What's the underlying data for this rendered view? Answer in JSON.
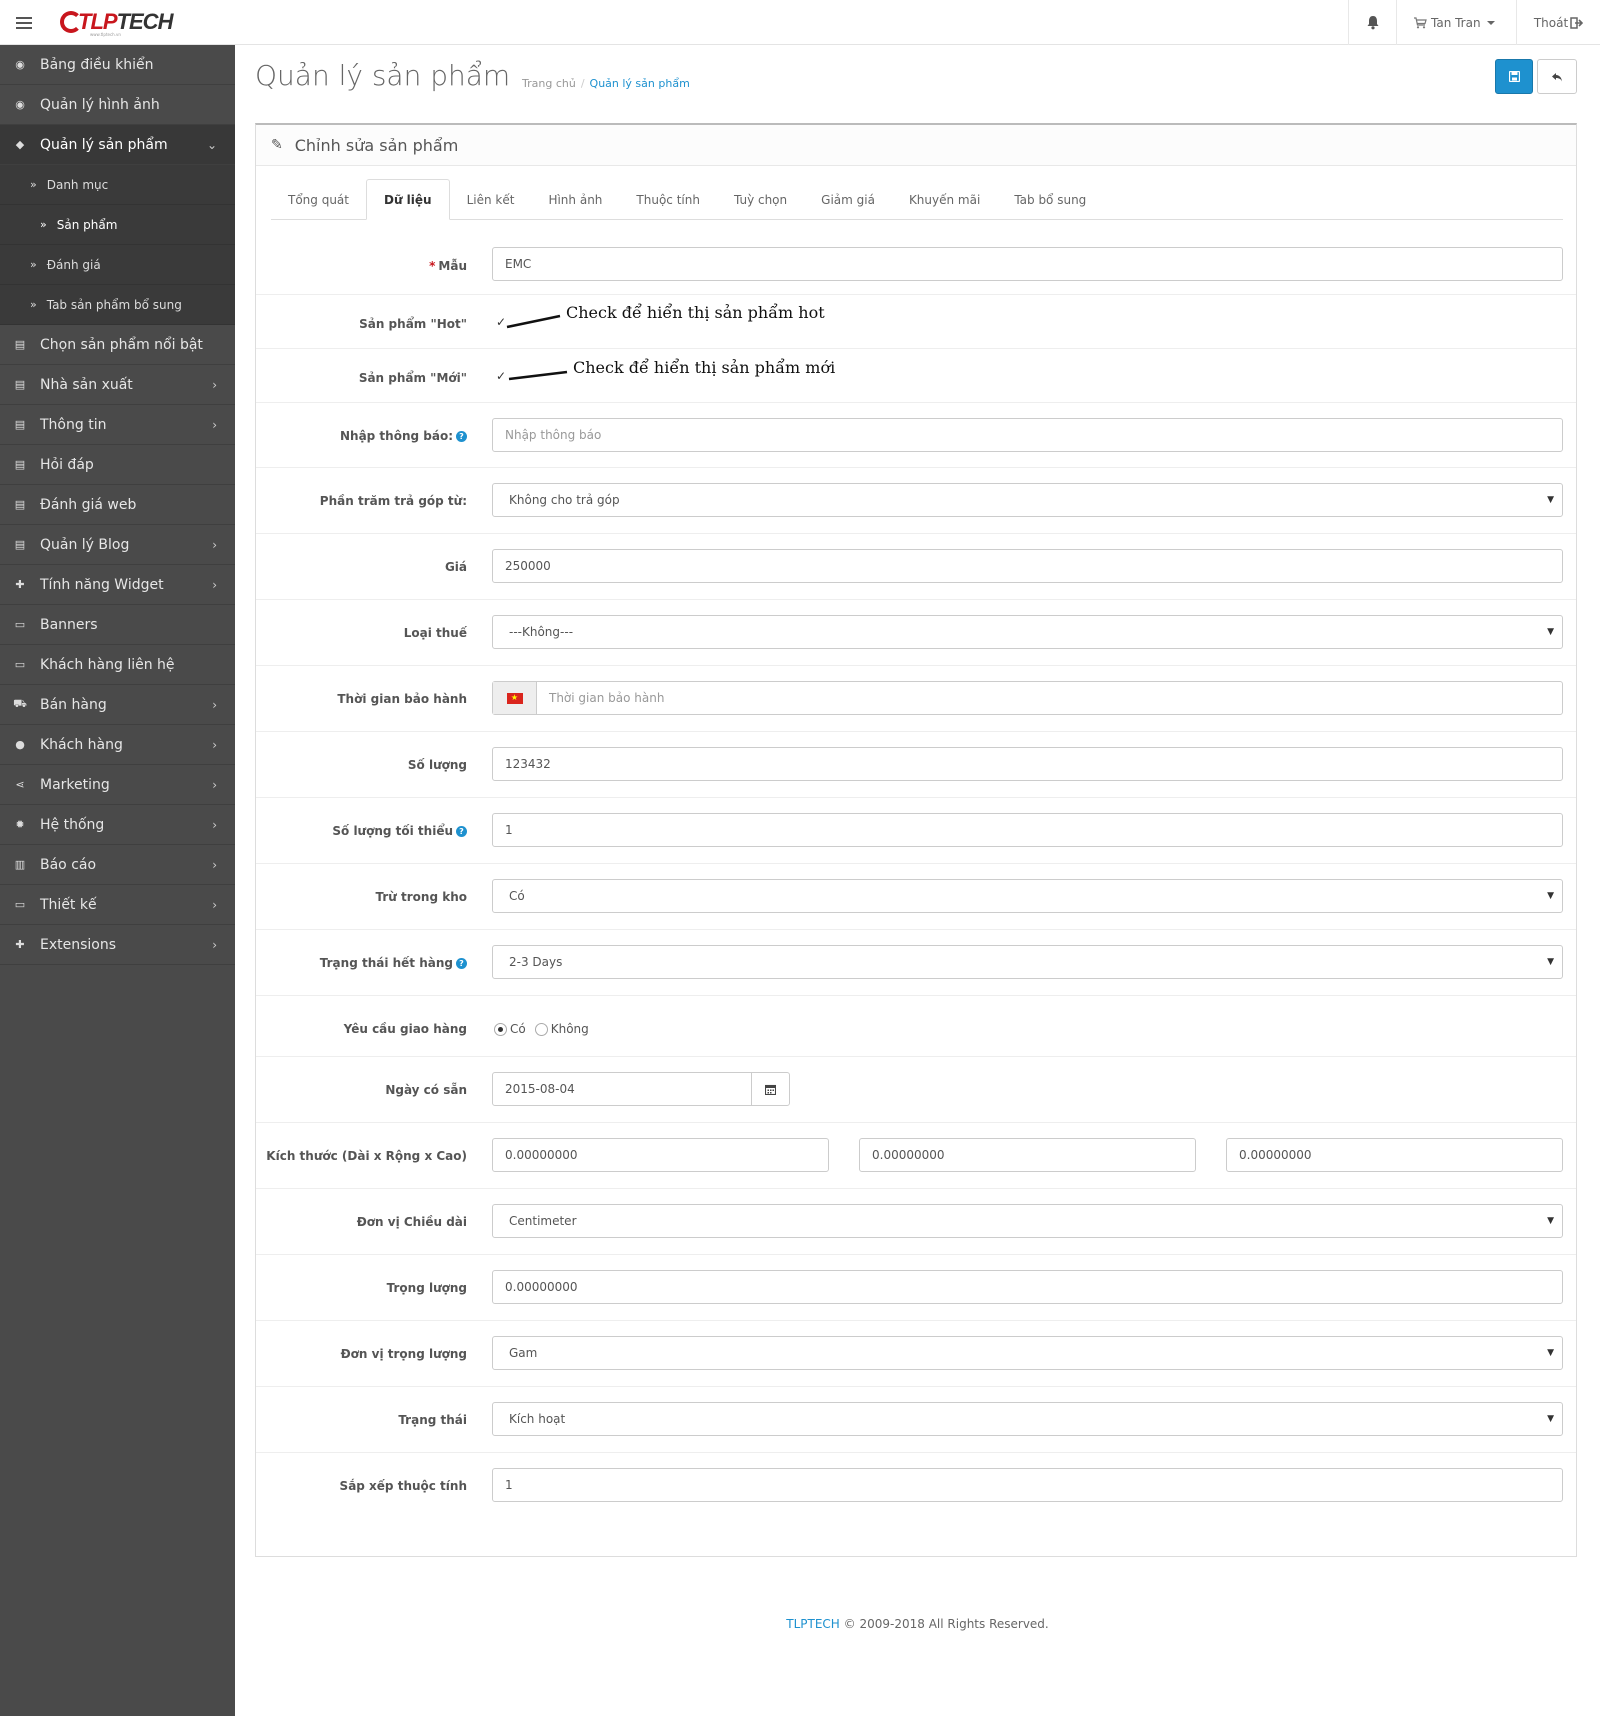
{
  "header": {
    "logo_text_red": "TLP",
    "logo_text_dark": "TECH",
    "logo_sub": "www.tlptech.vn",
    "user_name": "Tan Tran",
    "logout_label": "Thoát"
  },
  "sidebar": {
    "items": [
      {
        "label": "Bảng điều khiển",
        "icon": "dashboard-icon"
      },
      {
        "label": "Quản lý hình ảnh",
        "icon": "dashboard-icon"
      },
      {
        "label": "Quản lý sản phẩm",
        "icon": "tags-icon"
      },
      {
        "label": "Chọn sản phẩm nổi bật",
        "icon": "newspaper-icon"
      },
      {
        "label": "Nhà sản xuất",
        "icon": "newspaper-icon"
      },
      {
        "label": "Thông tin",
        "icon": "newspaper-icon"
      },
      {
        "label": "Hỏi đáp",
        "icon": "newspaper-icon"
      },
      {
        "label": "Đánh giá web",
        "icon": "newspaper-icon"
      },
      {
        "label": "Quản lý Blog",
        "icon": "newspaper-icon"
      },
      {
        "label": "Tính năng Widget",
        "icon": "puzzle-icon"
      },
      {
        "label": "Banners",
        "icon": "monitor-icon"
      },
      {
        "label": "Khách hàng liên hệ",
        "icon": "monitor-icon"
      },
      {
        "label": "Bán hàng",
        "icon": "cart-icon"
      },
      {
        "label": "Khách hàng",
        "icon": "user-icon"
      },
      {
        "label": "Marketing",
        "icon": "share-icon"
      },
      {
        "label": "Hệ thống",
        "icon": "gear-icon"
      },
      {
        "label": "Báo cáo",
        "icon": "bar-chart-icon"
      },
      {
        "label": "Thiết kế",
        "icon": "monitor-icon"
      },
      {
        "label": "Extensions",
        "icon": "puzzle-icon"
      }
    ],
    "sub_items": [
      {
        "label": "Danh mục"
      },
      {
        "label": "Sản phẩm"
      },
      {
        "label": "Đánh giá"
      },
      {
        "label": "Tab sản phẩm bổ sung"
      }
    ]
  },
  "page": {
    "title": "Quản lý sản phẩm",
    "breadcrumb_home": "Trang chủ",
    "breadcrumb_current": "Quản lý sản phẩm",
    "panel_title": "Chỉnh sửa sản phẩm"
  },
  "tabs": [
    "Tổng quát",
    "Dữ liệu",
    "Liên kết",
    "Hình ảnh",
    "Thuộc tính",
    "Tuỳ chọn",
    "Giảm giá",
    "Khuyến mãi",
    "Tab bổ sung"
  ],
  "form": {
    "model_label": "Mẫu",
    "model_value": "EMC",
    "hot_label": "Sản phẩm \"Hot\"",
    "new_label": "Sản phẩm \"Mới\"",
    "notice_label": "Nhập thông báo:",
    "notice_placeholder": "Nhập thông báo",
    "installment_label": "Phần trăm trả góp từ:",
    "installment_value": "Không cho trả góp",
    "price_label": "Giá",
    "price_value": "250000",
    "tax_label": "Loại thuế",
    "tax_value": "---Không---",
    "warranty_label": "Thời gian bảo hành",
    "warranty_placeholder": "Thời gian bảo hành",
    "quantity_label": "Số lượng",
    "quantity_value": "123432",
    "min_qty_label": "Số lượng tối thiểu",
    "min_qty_value": "1",
    "subtract_label": "Trừ trong kho",
    "subtract_value": "Có",
    "stock_status_label": "Trạng thái hết hàng",
    "stock_status_value": "2-3 Days",
    "shipping_label": "Yêu cầu giao hàng",
    "shipping_yes": "Có",
    "shipping_no": "Không",
    "date_label": "Ngày có sẵn",
    "date_value": "2015-08-04",
    "dimensions_label": "Kích thước (Dài x Rộng x Cao)",
    "length_value": "0.00000000",
    "width_value": "0.00000000",
    "height_value": "0.00000000",
    "length_class_label": "Đơn vị Chiều dài",
    "length_class_value": "Centimeter",
    "weight_label": "Trọng lượng",
    "weight_value": "0.00000000",
    "weight_class_label": "Đơn vị trọng lượng",
    "weight_class_value": "Gam",
    "status_label": "Trạng thái",
    "status_value": "Kích hoạt",
    "sort_label": "Sắp xếp thuộc tính",
    "sort_value": "1"
  },
  "annotations": {
    "hot_note": "Check để hiển thị sản phẩm hot",
    "new_note": "Check để hiển thị sản phẩm mới"
  },
  "footer": {
    "brand": "TLPTECH",
    "rest": "© 2009-2018 All Rights Reserved."
  },
  "colors": {
    "sidebar_bg": "#4a4a4a",
    "primary": "#1e91cf",
    "brand_red": "#c8161d"
  }
}
